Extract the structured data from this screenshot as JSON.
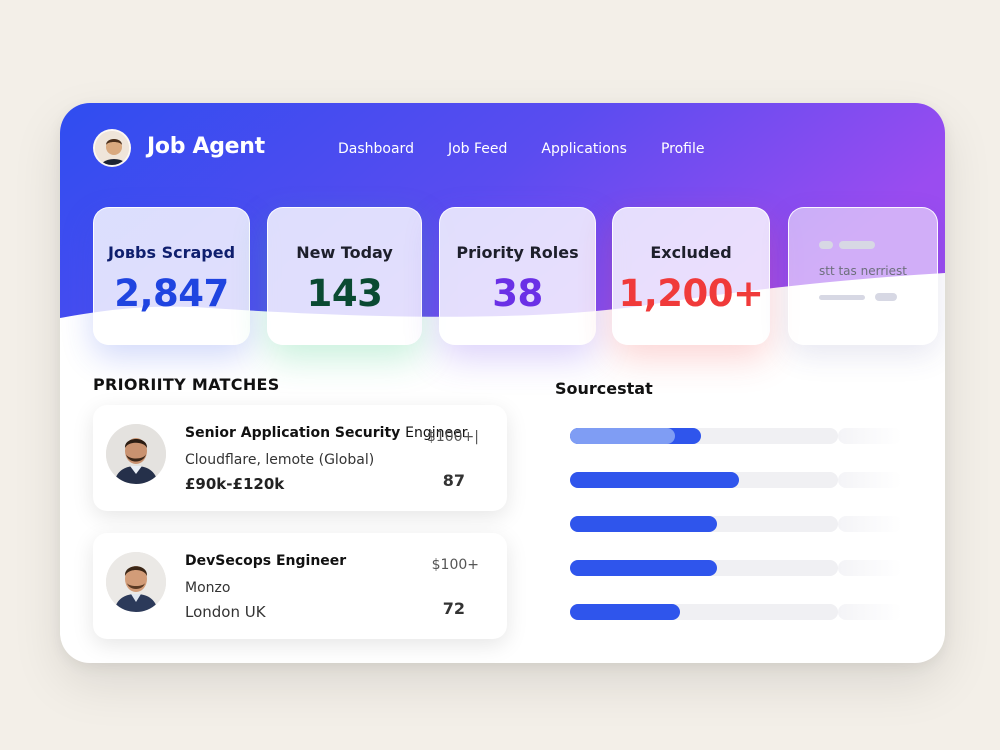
{
  "app": {
    "title": "Job Agent",
    "nav": [
      "Dashboard",
      "Job Feed",
      "Applications",
      "Profile"
    ]
  },
  "colors": {
    "hero_start": "#2f4df0",
    "hero_end": "#9a4cf0",
    "bar": "#2f55ec",
    "bar_light": "#7f9df4"
  },
  "stats": [
    {
      "label": "Joвbs Scraped",
      "value": "2,847",
      "color": "#1f44e0"
    },
    {
      "label": "New Today",
      "value": "143",
      "color": "#0a4a32"
    },
    {
      "label": "Priority Roles",
      "value": "38",
      "color": "#6a30e6"
    },
    {
      "label": "Excluded",
      "value": "1,200+",
      "color": "#f03a3a"
    },
    {
      "label": "stt tas nerriest",
      "value": ""
    }
  ],
  "priority": {
    "title": "PRIORIITY MATCHES",
    "items": [
      {
        "title": "Senior Application Security",
        "title_suffix": "Engineer",
        "company": "Cloudflare, lemote (Global)",
        "detail": "£90k-£120k",
        "salary": "$100+|",
        "score": "87",
        "avatar": "person-avatar"
      },
      {
        "title": "DevSecops Engineer",
        "title_suffix": "",
        "company": "Monzo",
        "detail": "London UK",
        "salary": "$100+",
        "score": "72",
        "avatar": "person-avatar"
      }
    ]
  },
  "sources": {
    "title": "Sourcestat",
    "bars": [
      {
        "fill": 0.49,
        "highlight": 0.39
      },
      {
        "fill": 0.63
      },
      {
        "fill": 0.55
      },
      {
        "fill": 0.55
      },
      {
        "fill": 0.41
      }
    ]
  }
}
